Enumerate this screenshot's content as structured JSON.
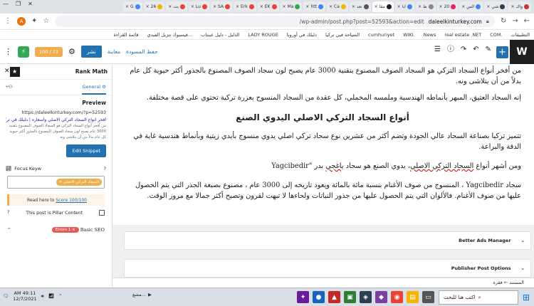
{
  "browser": {
    "tabs": [
      {
        "label": "واك",
        "color": "#c0392b"
      },
      {
        "label": "شي",
        "color": "#2c3e50"
      },
      {
        "label": "الس",
        "color": "#4285f4"
      },
      {
        "label": "20",
        "color": "#e91e63"
      },
      {
        "label": "ظ",
        "color": "#888888"
      },
      {
        "label": "ابا",
        "color": "#4285f4"
      },
      {
        "label": "مقا",
        "color": "#1e1e1e",
        "active": true
      },
      {
        "label": "نعد",
        "color": "#555555"
      },
      {
        "label": "Ca",
        "color": "#f4b400"
      },
      {
        "label": "htt",
        "color": "#4285f4"
      },
      {
        "label": "Ma",
        "color": "#34a853"
      },
      {
        "label": "EK",
        "color": "#ea4335"
      },
      {
        "label": "Erk",
        "color": "#ea4335"
      },
      {
        "label": "SA",
        "color": "#ea4335"
      },
      {
        "label": "Lu",
        "color": "#ea4335"
      },
      {
        "label": "بت",
        "color": "#ea4335"
      },
      {
        "label": "26",
        "color": "#f4b400"
      },
      {
        "label": "G",
        "color": "#4285f4"
      }
    ],
    "url_domain": "daleelkinturkey.com",
    "url_path": "/wp-admin/post.php?post=52593&action=edit",
    "avatar_letter": "A",
    "bookmarks": [
      "التطبيقات",
      "COM.",
      "real estate .NET",
      "News",
      "WIKI.",
      "cumhuriyet",
      "السياحة فيي تركيا",
      "دليلك في أوروبا",
      "LADY ROUGE",
      "الدليل - دليل عينتاب",
      "فيسبوك تنزيل الفيدي...",
      "قائمة القراءة"
    ]
  },
  "editor": {
    "publish_label": "نشر",
    "preview_label": "معاينة",
    "save_draft_label": "حفظ المسودة",
    "rankmath_score": "100 / 73"
  },
  "sidebar": {
    "title": "Rank Math",
    "tab_general": "General",
    "preview_heading": "Preview",
    "preview_url": "https://daleelkinturkey.com/?p=52593",
    "preview_title": "أفخر انواع السجاد التركي الاصلي وأسعاره | دليلك في تركيا",
    "preview_desc": "من أفخر أنواع السجاد التركي هو السجاد الصوف المصنوع بتقنية 3000 عام يصبح لون سجاد الصوف المصنوع بالجذور أكثر حيوية كل عام بدلاً من أن يتلاشى ونه",
    "edit_snippet": "Edit Snippet",
    "focus_keyword_label": "Focus Keyw",
    "focus_keyword": "السجاد التركي الاصلي",
    "read_here_prefix": "Read here to",
    "read_here_link": "Score 100/100",
    "pillar_label": "This post is Pillar Content",
    "basic_seo": "Basic SEO",
    "errors_badge": "Errors 1 ×"
  },
  "content": {
    "p1": "من أفخر أنواع السجاد التركي هو السجاد الصوف المصنوع بتقنية 3000 عام يصبح لون سجاد الصوف المصنوع بالجذور أكثر حيوية كل عام بدلاً من أن يتلاشى ونه.",
    "p2": "إنه السجاد العتيق، المبهر بأنماطه الهندسية وملمسه المخملي، كل عقدة من السجاد المنسوج بعزرة تركية تحتوي على قصة مختلفة.",
    "h2": "أنواع السجاد التركي الاصلي اليدوي الصنع",
    "p3": "تتميز تركيا بصناعة السجاد عالي الجودة وتضم أكثر من عشرين نوع سجاد تركي اصلي يدوي منسوج بأيدي زيتية وبأنماط هندسية غاية في الدقة والبراعة.",
    "p4_prefix": "ومن أشهر أنواع ",
    "p4_underline": "السجاد التركي الاصلي",
    "p4_mid": "، يدوي الصنع هو سجاد ",
    "p4_underline2": "ياغجي",
    "p4_suffix": " بدر \"Yagcibedir",
    "p5": "سجاد Yagcibedir ، المنسوج من صوف الأغنام بنسبة مائة بالمائة ويعود تاريخه إلى 3000 عام ، مصنوع بصبغة الجذر التي يتم الحصول عليها من صوف الأغنام. فالألوان التي يتم الحصول عليها من جذور النباتات ولحاءها لا تبهت لقرون وتصبح أكثر جمالا مع مرور الوقت.",
    "panel1": "Better Ads Manager",
    "panel2": "Publisher Post Options",
    "breadcrumb": "المستند ← فقرة"
  },
  "taskbar": {
    "search_placeholder": "اكتب هنا للبحث",
    "time": "AM 49:11",
    "date": "12/7/2021",
    "mashup_label": "مشغ..."
  }
}
